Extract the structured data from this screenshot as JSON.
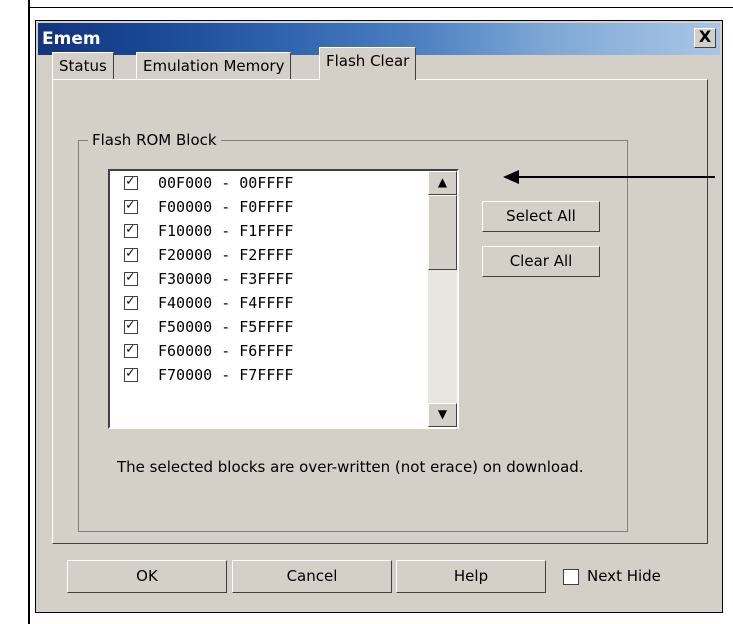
{
  "window": {
    "title": "Emem",
    "close_glyph": "X"
  },
  "tabs": [
    {
      "label": "Status",
      "active": false
    },
    {
      "label": "Emulation Memory",
      "active": false
    },
    {
      "label": "Flash Clear",
      "active": true
    }
  ],
  "group": {
    "label": "Flash ROM Block"
  },
  "blocks": [
    {
      "range": "00F000 - 00FFFF",
      "checked": true
    },
    {
      "range": "F00000 - F0FFFF",
      "checked": true
    },
    {
      "range": "F10000 - F1FFFF",
      "checked": true
    },
    {
      "range": "F20000 - F2FFFF",
      "checked": true
    },
    {
      "range": "F30000 - F3FFFF",
      "checked": true
    },
    {
      "range": "F40000 - F4FFFF",
      "checked": true
    },
    {
      "range": "F50000 - F5FFFF",
      "checked": true
    },
    {
      "range": "F60000 - F6FFFF",
      "checked": true
    },
    {
      "range": "F70000 - F7FFFF",
      "checked": true
    }
  ],
  "scrollbar": {
    "up_glyph": "▲",
    "down_glyph": "▼"
  },
  "buttons": {
    "select_all": "Select All",
    "clear_all": "Clear All"
  },
  "note": "The selected blocks are over-written (not erace) on download.",
  "footer": {
    "ok": "OK",
    "cancel": "Cancel",
    "help": "Help",
    "next_hide": "Next Hide",
    "next_hide_checked": false
  }
}
